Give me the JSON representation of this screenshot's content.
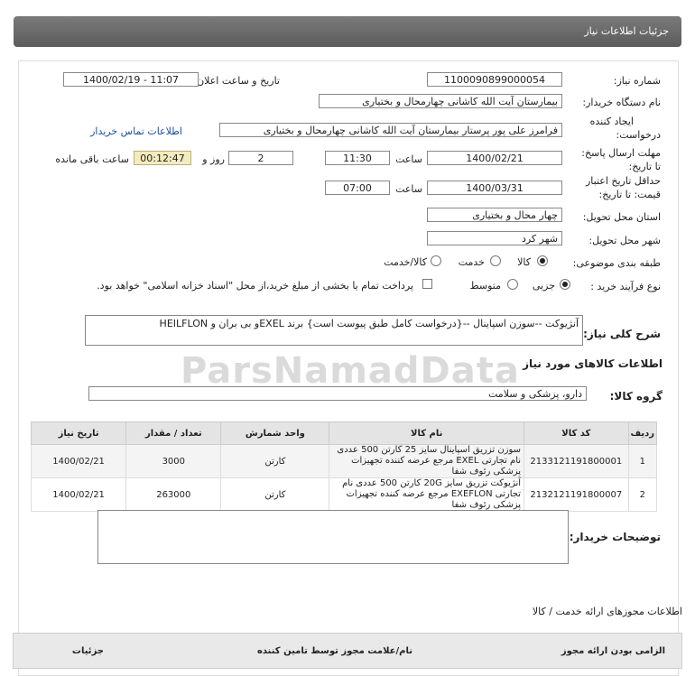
{
  "header": {
    "title": "جزئیات اطلاعات نیاز"
  },
  "form": {
    "need_number_label": "شماره نیاز:",
    "need_number": "1100090899000054",
    "announce_label": "تاریخ و ساعت اعلان عمومی:",
    "announce_value": "1400/02/19 - 11:07",
    "buyer_label": "نام دستگاه خریدار:",
    "buyer_value": "بیمارستان آیت الله کاشانی چهارمحال و بختیاری",
    "creator_label_1": "ایجاد کننده",
    "creator_label_2": "درخواست:",
    "creator_value": "فرامرز علی پور پرستار بیمارستان آیت الله کاشانی چهارمحال و بختیاری",
    "contact_link": "اطلاعات تماس خریدار",
    "deadline_label_1": "مهلت ارسال پاسخ:",
    "deadline_label_2": "تا تاریخ:",
    "deadline_date": "1400/02/21",
    "time_word": "ساعت",
    "deadline_time": "11:30",
    "days_value": "2",
    "days_word": "روز و",
    "timer_value": "00:12:47",
    "remaining_word": "ساعت باقی مانده",
    "validity_label_1": "حداقل تاریخ اعتبار",
    "validity_label_2": "قیمت: تا تاریخ:",
    "validity_date": "1400/03/31",
    "validity_time": "07:00",
    "province_label": "استان محل تحویل:",
    "province_value": "چهار محال و بختیاری",
    "city_label": "شهر محل تحویل:",
    "city_value": "شهر کرد",
    "category_label": "طبقه بندی موضوعی:",
    "category_options": [
      "کالا",
      "خدمت",
      "کالا/خدمت"
    ],
    "process_label": "نوع فرآیند خرید :",
    "process_options": [
      "جزیی",
      "متوسط"
    ],
    "payment_note": "پرداخت تمام یا بخشی از مبلغ خرید،از محل \"اسناد خزانه اسلامی\" خواهد بود.",
    "summary_label": "شرح کلی نیاز:",
    "summary_value": "آنژیوکت --سوزن اسپاینال --{درخواست کامل طبق پیوست است} برند   EXELو  بی بران  و HEILFLON",
    "items_title": "اطلاعات کالاهای مورد نیاز",
    "group_label": "گروه کالا:",
    "group_value": "دارو، پزشکی و سلامت",
    "buyer_notes_label": "توضیحات خریدار:",
    "services_title": "اطلاعات مجوزهای ارائه خدمت / کالا"
  },
  "table": {
    "headers": [
      "ردیف",
      "کد کالا",
      "نام کالا",
      "واحد شمارش",
      "تعداد / مقدار",
      "تاریخ نیاز"
    ],
    "rows": [
      {
        "row": "1",
        "code": "2133121191800001",
        "name": "سوزن تزریق اسپاینال سایز 25 کارتن 500 عددی نام تجارتی EXEL مرجع عرضه کننده تجهیزات پزشکی رئوف شفا",
        "unit": "کارتن",
        "qty": "3000",
        "date": "1400/02/21"
      },
      {
        "row": "2",
        "code": "2132121191800007",
        "name": "آنژیوکت تزریق سایز 20G کارتن 500 عددی نام تجارتی EXEFLON مرجع عرضه کننده تجهیزات پزشکی رئوف شفا",
        "unit": "کارتن",
        "qty": "263000",
        "date": "1400/02/21"
      }
    ]
  },
  "services_table": {
    "headers": [
      "الزامی بودن ارائه مجوز",
      "نام/علامت مجوز توسط تامین کننده",
      "جزئیات"
    ]
  },
  "watermark": "ParsNamadData"
}
